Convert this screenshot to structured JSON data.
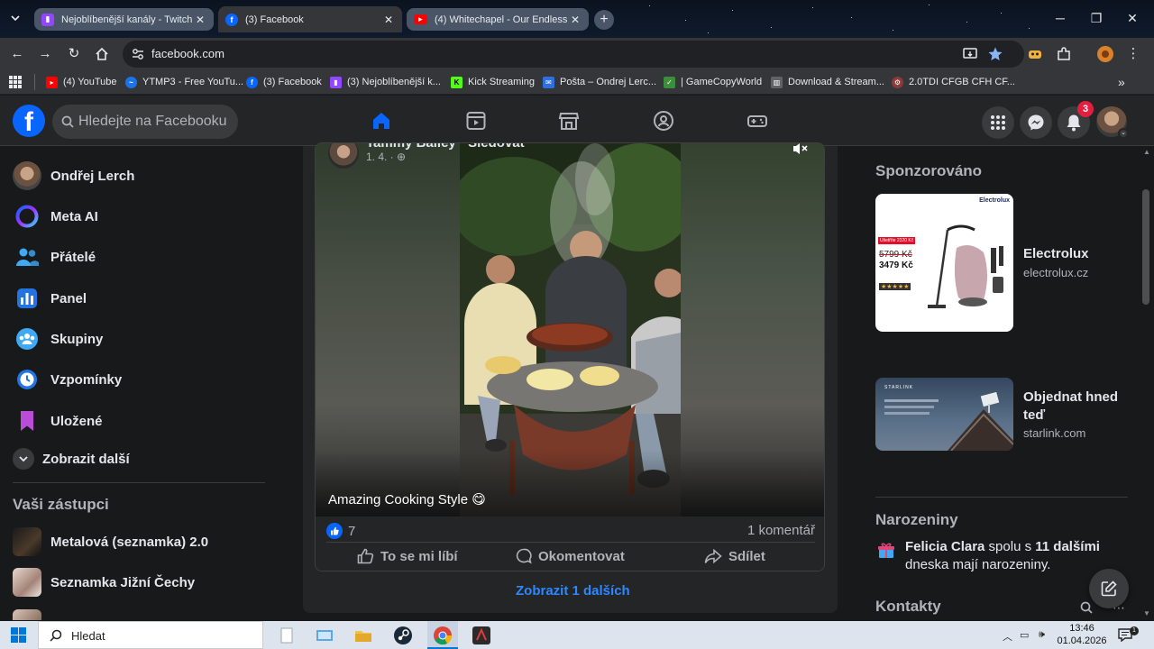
{
  "browser": {
    "tabs": [
      {
        "label": "Nejoblíbenější kanály - Twitch",
        "icon": "twitch-icon",
        "active": false
      },
      {
        "label": "(3) Facebook",
        "icon": "facebook-icon",
        "active": true
      },
      {
        "label": "(4) Whitechapel - Our Endless V",
        "icon": "youtube-icon",
        "active": false
      }
    ],
    "new_tab_symbol": "+",
    "address": "facebook.com",
    "bookmarks": [
      {
        "label": "(4) YouTube",
        "icon": "youtube-icon"
      },
      {
        "label": "YTMP3 - Free YouTu...",
        "icon": "ytmp3-icon"
      },
      {
        "label": "(3) Facebook",
        "icon": "facebook-icon"
      },
      {
        "label": "(3) Nejoblíbenější k...",
        "icon": "twitch-icon"
      },
      {
        "label": "Kick Streaming",
        "icon": "kick-icon"
      },
      {
        "label": "Pošta – Ondrej Lerc...",
        "icon": "mail-icon"
      },
      {
        "label": "| GameCopyWorld",
        "icon": "gamecopyworld-icon"
      },
      {
        "label": "Download & Stream...",
        "icon": "library-icon"
      },
      {
        "label": "2.0TDI CFGB CFH CF...",
        "icon": "car-parts-icon"
      }
    ],
    "bookmarks_overflow": "»"
  },
  "facebook": {
    "logo": "f",
    "search_placeholder": "Hledejte na Facebooku",
    "notifications_count": "3",
    "sidebar": {
      "items": [
        {
          "label": "Ondřej Lerch",
          "icon": "profile-avatar"
        },
        {
          "label": "Meta AI",
          "icon": "meta-ai-icon"
        },
        {
          "label": "Přátelé",
          "icon": "friends-icon"
        },
        {
          "label": "Panel",
          "icon": "panel-icon"
        },
        {
          "label": "Skupiny",
          "icon": "groups-icon"
        },
        {
          "label": "Vzpomínky",
          "icon": "memories-icon"
        },
        {
          "label": "Uložené",
          "icon": "saved-icon"
        }
      ],
      "show_more": "Zobrazit další",
      "shortcuts_title": "Vaši zástupci",
      "shortcuts": [
        {
          "label": "Metalová (seznamka) 2.0"
        },
        {
          "label": "Seznamka Jižní Čechy"
        }
      ]
    },
    "post": {
      "author": "Tammy Bailey · Sledovat",
      "date": "1. 4. · ",
      "caption": "Amazing Cooking Style 😋",
      "reactions_count": "7",
      "comments": "1 komentář",
      "actions": {
        "like": "To se mi líbí",
        "comment": "Okomentovat",
        "share": "Sdílet"
      },
      "more_comments": "Zobrazit 1 dalších"
    },
    "right": {
      "sponsored_title": "Sponzorováno",
      "ads": [
        {
          "title": "Electrolux",
          "domain": "electrolux.cz",
          "brand": "Electrolux",
          "badge": "Ušetříte 2320 Kč",
          "old_price": "5799 Kč",
          "new_price": "3479 Kč",
          "stars": "★★★★★"
        },
        {
          "title": "Objednat hned teď",
          "domain": "starlink.com",
          "brand": "STARLINK"
        }
      ],
      "birthdays_title": "Narozeniny",
      "birthday_name": "Felicia Clara",
      "birthday_mid": " spolu s ",
      "birthday_count": "11 dalšími",
      "birthday_tail": " dneska mají narozeniny.",
      "contacts_title": "Kontakty"
    }
  },
  "taskbar": {
    "search_placeholder": "Hledat",
    "time": "13:46",
    "date": "01.04.2026"
  },
  "colors": {
    "fb_blue": "#0866ff",
    "fb_bg": "#18191a",
    "fb_card": "#242526",
    "notif_red": "#e41e3f"
  }
}
